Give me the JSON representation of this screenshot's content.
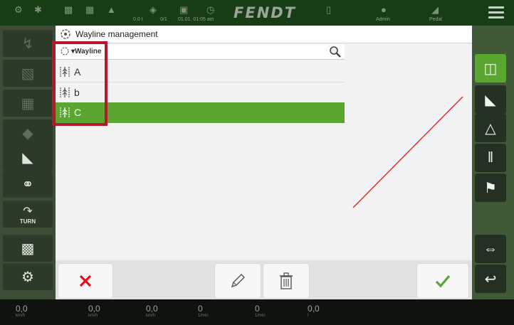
{
  "topbar": {
    "brand": "FENDT",
    "status_labels": [
      "0.0 t",
      "0/1",
      "01.01. 01:05 am",
      "Admin",
      "Pedal"
    ]
  },
  "dialog": {
    "title": "Wayline management",
    "list_header": "▾Wayline",
    "items": [
      {
        "label": "A",
        "selected": false
      },
      {
        "label": "b",
        "selected": false
      },
      {
        "label": "C",
        "selected": true
      }
    ]
  },
  "left_sidebar": {
    "turn_label": "TURN"
  },
  "bottombar": {
    "readouts": [
      {
        "main": "0,0",
        "unit": "km/h"
      },
      {
        "main": "0,0",
        "unit": "km/h"
      },
      {
        "main": "0,0",
        "unit": "km/h"
      },
      {
        "main": "0",
        "unit": "1/min"
      },
      {
        "main": "0",
        "unit": "1/min"
      },
      {
        "main": "0,0",
        "unit": "l"
      }
    ]
  },
  "colors": {
    "selection": "#5aa630",
    "highlight": "#b5172c",
    "cancel": "#e3101b",
    "confirm": "#5aa630"
  }
}
